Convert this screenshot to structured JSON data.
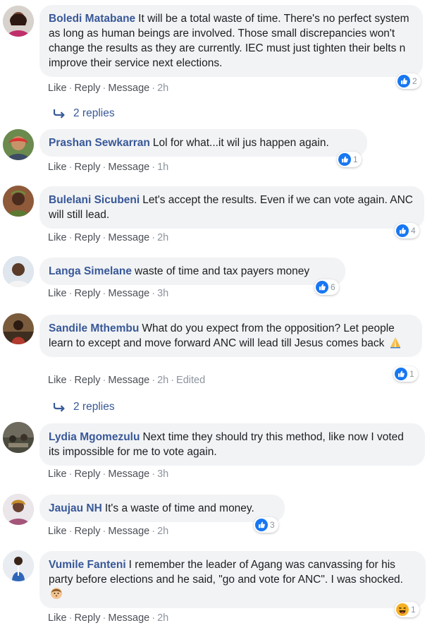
{
  "colors": {
    "author": "#385898",
    "bubble": "#f2f3f5",
    "like_blue": "#1877f2",
    "meta": "#8d949e"
  },
  "actions": {
    "like": "Like",
    "reply": "Reply",
    "message": "Message",
    "sep": "·"
  },
  "comments": [
    {
      "author": "Boledi Matabane",
      "text": "It will be a total waste of time. There's no perfect system as long as human beings are involved. Those small discrepancies won't change the results as they are currently. IEC must just tighten their belts n improve their service next elections.",
      "time": "2h",
      "edited": "",
      "reaction_icon": "like-icon",
      "reaction_count": "2",
      "replies": "2 replies"
    },
    {
      "author": "Prashan Sewkarran",
      "text": "Lol for what...it wil jus happen again.",
      "time": "1h",
      "edited": "",
      "reaction_icon": "like-icon",
      "reaction_count": "1",
      "replies": ""
    },
    {
      "author": "Bulelani Sicubeni",
      "text": "Let's accept the results. Even if we can vote again. ANC will still lead.",
      "time": "2h",
      "edited": "",
      "reaction_icon": "like-icon",
      "reaction_count": "4",
      "replies": ""
    },
    {
      "author": "Langa Simelane",
      "text": "waste of time and tax payers money",
      "time": "3h",
      "edited": "",
      "reaction_icon": "like-icon",
      "reaction_count": "6",
      "replies": ""
    },
    {
      "author": "Sandile Mthembu",
      "text": "What do you expect from the opposition? Let people learn to except and move forward ANC will lead till Jesus comes back",
      "emoji": "praying-hands-emoji",
      "time": "2h",
      "edited": "Edited",
      "reaction_icon": "like-icon",
      "reaction_count": "1",
      "replies": "2 replies"
    },
    {
      "author": "Lydia Mgomezulu",
      "text": "Next time they should try this method, like now I voted its impossible for me to vote again.",
      "time": "3h",
      "edited": "",
      "reaction_icon": "",
      "reaction_count": "",
      "replies": ""
    },
    {
      "author": "Jaujau NH",
      "text": "It's a waste of time and money.",
      "time": "2h",
      "edited": "",
      "reaction_icon": "like-icon",
      "reaction_count": "3",
      "replies": ""
    },
    {
      "author": "Vumile Fanteni",
      "text": "I remember the leader of Agang was canvassing for his party before elections and he said, \"go and vote for ANC\". I was shocked.",
      "emoji": "flushed-face-emoji",
      "time": "2h",
      "edited": "",
      "reaction_icon": "haha-icon",
      "reaction_count": "1",
      "replies": ""
    }
  ]
}
